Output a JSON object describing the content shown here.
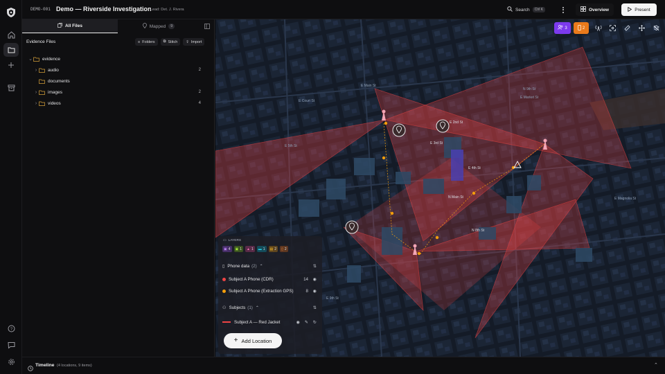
{
  "app": {
    "case_id": "DEMO-001",
    "title": "Demo — Riverside Investigation",
    "lead": "Lead: Det. J. Rivera"
  },
  "topbar": {
    "search_label": "Search",
    "search_shortcut": "Ctrl K",
    "overview_label": "Overview",
    "present_label": "Present"
  },
  "panel": {
    "tabs": [
      {
        "label": "All Files"
      },
      {
        "label": "Mapped",
        "badge": "9"
      }
    ],
    "section_title": "Evidence Files",
    "actions": {
      "folders": "Folders",
      "stitch": "Stitch",
      "import": "Import"
    },
    "tree": [
      {
        "label": "evidence",
        "count": ""
      },
      {
        "label": "audio",
        "count": "2"
      },
      {
        "label": "documents",
        "count": ""
      },
      {
        "label": "images",
        "count": "2"
      },
      {
        "label": "videos",
        "count": "4"
      }
    ]
  },
  "map": {
    "toolbar": {
      "subjects_badge": "3",
      "devices_badge": "2"
    },
    "streets": [
      "E Main St",
      "E Market St",
      "E Court St",
      "E 2nd St",
      "E 3rd St",
      "E 4th St",
      "N Main St",
      "N 8th St",
      "N 9th St",
      "E 5th St",
      "E Magnolia St",
      "E 9th St"
    ],
    "layers": {
      "header": "LAYERS",
      "chips": [
        {
          "count": "4",
          "color": "#a855f7"
        },
        {
          "count": "1",
          "color": "#84cc16"
        },
        {
          "count": "1",
          "color": "#ec4899"
        },
        {
          "count": "1",
          "color": "#06b6d4"
        },
        {
          "count": "2",
          "color": "#f59e0b"
        },
        {
          "count": "2",
          "color": "#f97316"
        }
      ],
      "phone_group": {
        "label": "Phone data",
        "count": "(2)"
      },
      "phone_items": [
        {
          "label": "Subject A Phone (CDR)",
          "count": "14",
          "color": "#ef4444"
        },
        {
          "label": "Subject A Phone (Extraction GPS)",
          "count": "8",
          "color": "#f59e0b"
        }
      ],
      "subjects_group": {
        "label": "Subjects",
        "count": "(1)"
      },
      "subject_items": [
        {
          "label": "Subject A — Red Jacket",
          "color": "#ef4444"
        }
      ]
    },
    "add_location": "Add Location"
  },
  "timeline": {
    "label": "Timeline",
    "summary": "(4 locations, 9 items)"
  },
  "colors": {
    "accent_red": "#ef4444",
    "accent_orange": "#f59e0b",
    "map_bg": "#161e2b",
    "subjects_purple": "#7c3aed",
    "devices_orange": "#ea7a1b"
  }
}
